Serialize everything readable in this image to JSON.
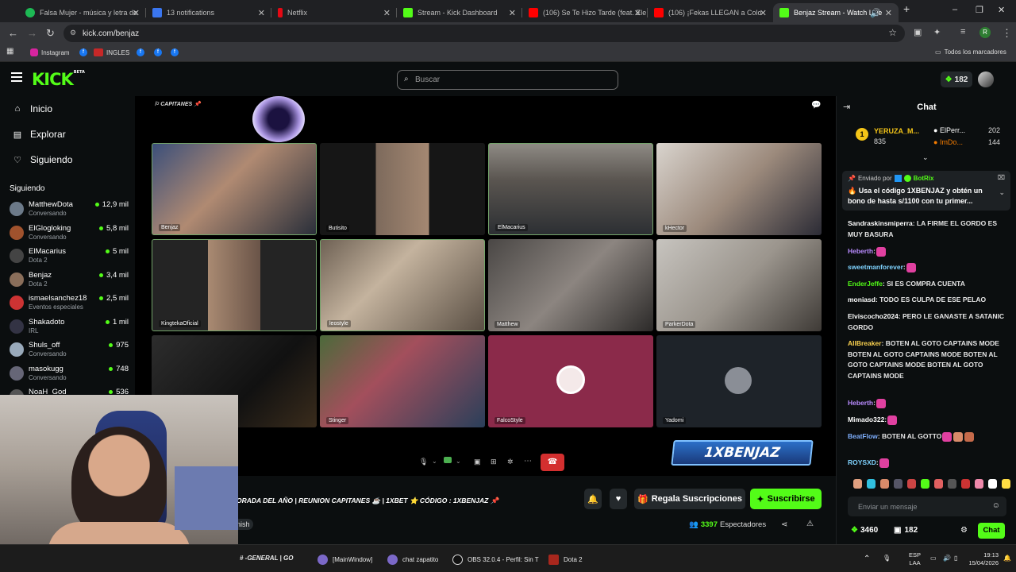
{
  "browser": {
    "tabs": [
      {
        "title": "Falsa Mujer - música y letra de",
        "color": "#1db954"
      },
      {
        "title": "13 notifications",
        "color": "#3a76f0"
      },
      {
        "title": "Netflix",
        "color": "#e50914"
      },
      {
        "title": "Stream - Kick Dashboard",
        "color": "#53fc18"
      },
      {
        "title": "(106) Se Te Hizo Tarde (feat. Ele",
        "color": "#ff0000"
      },
      {
        "title": "(106) ¡Fekas LLEGAN a Colo",
        "color": "#ff0000"
      },
      {
        "title": "Benjaz Stream - Watch Live",
        "color": "#53fc18"
      }
    ],
    "url": "kick.com/benjaz",
    "bookmarks": [
      "Instagram",
      "INGLES"
    ],
    "bookmarks_folder": "Todos los marcadores",
    "profile_initial": "R"
  },
  "header": {
    "logo": "KICK",
    "logo_badge": "BETA",
    "search_placeholder": "Buscar",
    "points": "182"
  },
  "sidebar": {
    "nav": [
      {
        "label": "Inicio",
        "icon": "home-icon"
      },
      {
        "label": "Explorar",
        "icon": "compass-icon"
      },
      {
        "label": "Siguiendo",
        "icon": "heart-icon"
      }
    ],
    "section_title": "Siguiendo",
    "following": [
      {
        "name": "MatthewDota",
        "category": "Conversando",
        "viewers": "12,9 mil",
        "color": "#6c7a89"
      },
      {
        "name": "ElGlogloking",
        "category": "Conversando",
        "viewers": "5,8 mil",
        "color": "#a0522d"
      },
      {
        "name": "ElMacarius",
        "category": "Dota 2",
        "viewers": "5 mil",
        "color": "#444"
      },
      {
        "name": "Benjaz",
        "category": "Dota 2",
        "viewers": "3,4 mil",
        "color": "#8a6e5a"
      },
      {
        "name": "ismaelsanchez18",
        "category": "Eventos especiales",
        "viewers": "2,5 mil",
        "color": "#c33"
      },
      {
        "name": "Shakadoto",
        "category": "IRL",
        "viewers": "1 mil",
        "color": "#334"
      },
      {
        "name": "Shuls_off",
        "category": "Conversando",
        "viewers": "975",
        "color": "#9ab"
      },
      {
        "name": "masokugg",
        "category": "Conversando",
        "viewers": "748",
        "color": "#667"
      },
      {
        "name": "NoaH_God",
        "category": "",
        "viewers": "536",
        "color": "#555"
      }
    ]
  },
  "stage": {
    "room_label": "CAPITANES",
    "tiles": [
      {
        "name": "Benjaz",
        "bg": "linear-gradient(135deg,#3b4f7a 0%,#b08a72 45%,#2a2f3a 100%)"
      },
      {
        "name": "Butisito",
        "bg": "linear-gradient(90deg,#161616 0%,#161616 34%,#7d6a5c 34%,#a48872 66%,#161616 66%)"
      },
      {
        "name": "ElMacarius",
        "bg": "linear-gradient(180deg,#8e8a84 0%,#5a5550 40%,#2c2f33 100%)"
      },
      {
        "name": "kHector",
        "bg": "linear-gradient(135deg,#d9d4ce 0%,#9c8a7c 50%,#2b2b35 100%)"
      },
      {
        "name": "KingtekaOficial",
        "bg": "linear-gradient(90deg,#242424 0%,#242424 34%,#a98a72 34%,#6a5448 66%,#242424 66%)"
      },
      {
        "name": "leostyle",
        "bg": "linear-gradient(135deg,#6e6154 0%,#c4b39e 40%,#5a4f44 100%)"
      },
      {
        "name": "Matthew",
        "bg": "linear-gradient(135deg,#4a4745 0%,#8c8580 50%,#2c2a29 100%)"
      },
      {
        "name": "ParkerDota",
        "bg": "linear-gradient(135deg,#c7c4bf 0%,#9b958d 50%,#3e3a36 100%)"
      },
      {
        "name": "",
        "bg": "linear-gradient(135deg,#2d2d2d 0%,#111 60%,#3a2c1c 100%)"
      },
      {
        "name": "Stinger",
        "bg": "linear-gradient(135deg,#4b6a3a 0%,#a34f5c 40%,#2a3f5a 100%)"
      },
      {
        "name": "FalcoStyle",
        "bg": "#8b2a4a"
      },
      {
        "name": "Yadomi",
        "bg": "#1e2329"
      }
    ],
    "promo_code_banner": "1XBENJAZ"
  },
  "stream": {
    "title": "ORADA DEL AÑO | REUNION CAPITANES ☕ | 1XBET ⭐ CÓDIGO : 1XBENJAZ 📌",
    "tag": "nish",
    "gift_label": "Regala Suscripciones",
    "subscribe_label": "Suscribirse",
    "viewers": "3397",
    "viewers_label": "Espectadores"
  },
  "chat": {
    "title": "Chat",
    "leaderboard": [
      {
        "name": "YERUZA_M...",
        "points": "835"
      },
      {
        "name": "ElPerr...",
        "points": "202"
      },
      {
        "name": "ImDo...",
        "points": "144"
      }
    ],
    "pinned_by_label": "Enviado por",
    "pinned_by": "BotRix",
    "pinned_text": "🔥 Usa el código 1XBENJAZ y obtén un bono de hasta s/1100 con tu primer...",
    "messages": [
      {
        "user": "Sandraskinsmiperra",
        "color": "#ffffff",
        "text": ": LA FIRME EL GORDO ES MUY BASURA"
      },
      {
        "user": "Heberth",
        "color": "#b98bff",
        "text": ":"
      },
      {
        "user": "sweetmanforever",
        "color": "#7fd3ff",
        "text": ":"
      },
      {
        "user": "EnderJeffe",
        "color": "#53fc18",
        "text": ": SI ES COMPRA CUENTA"
      },
      {
        "user": "moniasd",
        "color": "#ffffff",
        "text": ": TODO ES CULPA DE ESE PELAO"
      },
      {
        "user": "Elviscocho2024",
        "color": "#ffffff",
        "text": ": PERO LE GANASTE A SATANIC GORDO"
      },
      {
        "user": "AllBreaker",
        "color": "#fbd24f",
        "text": ": BOTEN AL GOTO CAPTAINS MODE BOTEN AL GOTO CAPTAINS MODE BOTEN AL GOTO CAPTAINS MODE BOTEN AL GOTO CAPTAINS MODE"
      },
      {
        "user": "Heberth",
        "color": "#b98bff",
        "text": ":"
      },
      {
        "user": "Mimado322",
        "color": "#ffffff",
        "text": ":"
      },
      {
        "user": "BeatFlow",
        "color": "#7fb0ff",
        "text": ": BOTEN AL GOTTO"
      },
      {
        "user": "ROYSXD",
        "color": "#7fd3ff",
        "text": ":"
      }
    ],
    "input_placeholder": "Enviar un mensaje",
    "balance": "3460",
    "points": "182",
    "send_label": "Chat"
  },
  "taskbar": {
    "items": [
      "# -GENERAL | GO",
      "[MainWindow]",
      "chat zapatito",
      "OBS 32.0.4 - Perfil: Sin T",
      "Dota 2"
    ],
    "lang": "ESP",
    "lang2": "LAA",
    "time": "19:13",
    "date": "15/04/2026"
  }
}
